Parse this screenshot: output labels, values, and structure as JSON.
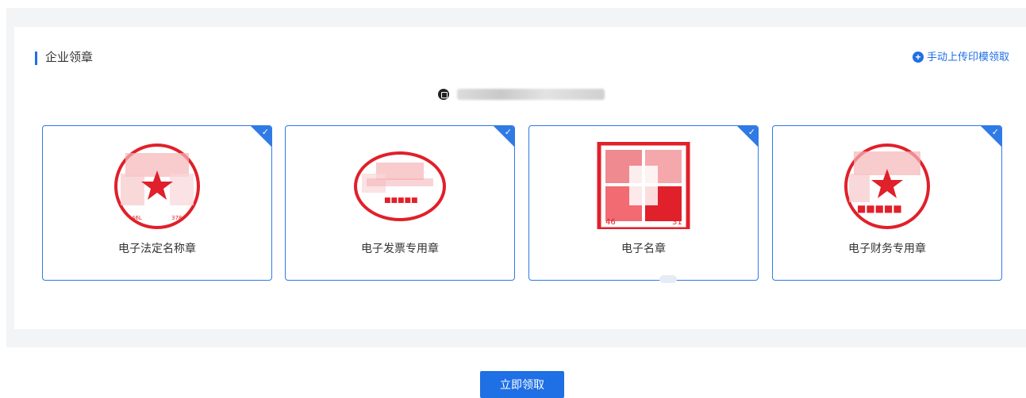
{
  "section": {
    "title": "企业领章"
  },
  "manual_upload": {
    "label": "手动上传印模领取",
    "icon": "plus-circle-icon"
  },
  "company": {
    "name": "■■■■■■■■■■■■",
    "icon": "building-icon"
  },
  "seals": [
    {
      "label": "电子法定名称章",
      "shape": "circle",
      "selected": true
    },
    {
      "label": "电子发票专用章",
      "shape": "oval",
      "selected": true
    },
    {
      "label": "电子名章",
      "shape": "square",
      "selected": true
    },
    {
      "label": "电子财务专用章",
      "shape": "circle",
      "selected": true
    }
  ],
  "submit": {
    "label": "立即领取"
  },
  "colors": {
    "accent": "#1f6fe5",
    "seal_red": "#e0202a"
  }
}
